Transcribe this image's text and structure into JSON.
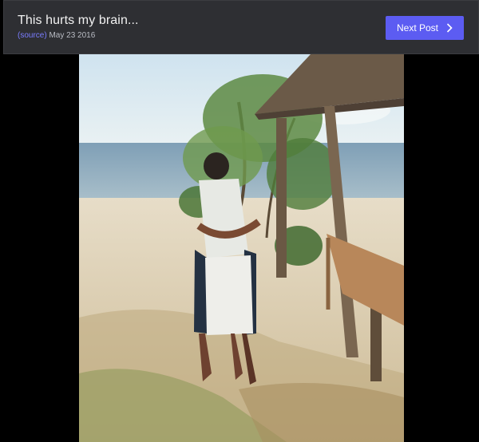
{
  "post": {
    "title": "This hurts my brain...",
    "source_label": "(source)",
    "date": "May 23 2016"
  },
  "nav": {
    "next_label": "Next Post",
    "next_icon": "chevron-right-icon"
  },
  "colors": {
    "header_bg": "#2e2f33",
    "accent": "#5c5cf2",
    "source_link": "#7a7dff",
    "page_bg": "#000000"
  }
}
